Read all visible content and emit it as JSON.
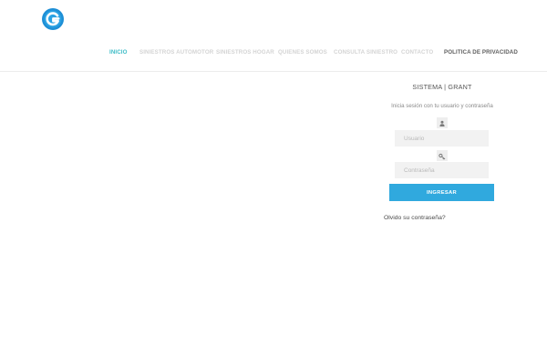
{
  "header": {
    "logo_icon": "circle-g-logo",
    "nav": [
      {
        "label": "INICIO",
        "state": "active"
      },
      {
        "label": "SINIESTROS AUTOMOTOR",
        "state": "faded"
      },
      {
        "label": "SINIESTROS HOGAR",
        "state": "faded"
      },
      {
        "label": "QUIENES SOMOS",
        "state": "faded"
      },
      {
        "label": "CONSULTA SINIESTRO",
        "state": "faded"
      },
      {
        "label": "CONTACTO",
        "state": "faded"
      },
      {
        "label": "POLITICA DE PRIVACIDAD",
        "state": "dark"
      }
    ]
  },
  "login": {
    "title": "SISTEMA | GRANT",
    "subtitle": "Inicia sesión con tu usuario y contraseña",
    "user_icon": "user-icon",
    "key_icon": "key-icon",
    "username_placeholder": "Usuario",
    "password_placeholder": "Contraseña",
    "submit_label": "INGRESAR",
    "forgot_label": "Olvido su contraseña?"
  },
  "colors": {
    "accent": "#3dbcc6",
    "button": "#30a9de",
    "logo_blue": "#1e8fd6"
  }
}
